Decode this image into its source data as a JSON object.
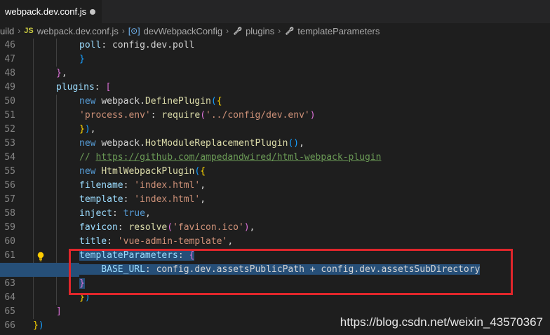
{
  "tab": {
    "title": "webpack.dev.conf.js"
  },
  "breadcrumb": {
    "items": [
      {
        "label": "uild"
      },
      {
        "label": "webpack.dev.conf.js",
        "icon": "js-file-icon"
      },
      {
        "label": "devWebpackConfig",
        "icon": "object-icon"
      },
      {
        "label": "plugins",
        "icon": "wrench-icon"
      },
      {
        "label": "templateParameters",
        "icon": "wrench-icon"
      }
    ]
  },
  "editor": {
    "line_numbers": [
      "46",
      "47",
      "48",
      "49",
      "50",
      "51",
      "52",
      "53",
      "54",
      "55",
      "56",
      "57",
      "58",
      "59",
      "60",
      "61",
      "62",
      "63",
      "64",
      "65",
      "66"
    ],
    "lines": [
      [
        {
          "t": "poll",
          "c": "p"
        },
        {
          "t": ": config.dev.poll",
          "c": "w"
        }
      ],
      [
        {
          "t": "}",
          "c": "b3"
        }
      ],
      [
        {
          "t": "}",
          "c": "b2"
        },
        {
          "t": ",",
          "c": "w"
        }
      ],
      [
        {
          "t": "plugins",
          "c": "p"
        },
        {
          "t": ": ",
          "c": "w"
        },
        {
          "t": "[",
          "c": "b2"
        }
      ],
      [
        {
          "t": "new ",
          "c": "k"
        },
        {
          "t": "webpack.",
          "c": "w"
        },
        {
          "t": "DefinePlugin",
          "c": "f"
        },
        {
          "t": "(",
          "c": "b3"
        },
        {
          "t": "{",
          "c": "b1"
        }
      ],
      [
        {
          "t": "'process.env'",
          "c": "s"
        },
        {
          "t": ": ",
          "c": "w"
        },
        {
          "t": "require",
          "c": "f"
        },
        {
          "t": "(",
          "c": "b2"
        },
        {
          "t": "'../config/dev.env'",
          "c": "s"
        },
        {
          "t": ")",
          "c": "b2"
        }
      ],
      [
        {
          "t": "}",
          "c": "b1"
        },
        {
          "t": ")",
          "c": "b3"
        },
        {
          "t": ",",
          "c": "w"
        }
      ],
      [
        {
          "t": "new ",
          "c": "k"
        },
        {
          "t": "webpack.",
          "c": "w"
        },
        {
          "t": "HotModuleReplacementPlugin",
          "c": "f"
        },
        {
          "t": "(",
          "c": "b3"
        },
        {
          "t": ")",
          "c": "b3"
        },
        {
          "t": ",",
          "c": "w"
        }
      ],
      [
        {
          "t": "// ",
          "c": "c"
        },
        {
          "t": "https://github.com/ampedandwired/html-webpack-plugin",
          "c": "cu"
        }
      ],
      [
        {
          "t": "new ",
          "c": "k"
        },
        {
          "t": "HtmlWebpackPlugin",
          "c": "f"
        },
        {
          "t": "(",
          "c": "b3"
        },
        {
          "t": "{",
          "c": "b1"
        }
      ],
      [
        {
          "t": "filename",
          "c": "p"
        },
        {
          "t": ": ",
          "c": "w"
        },
        {
          "t": "'index.html'",
          "c": "s"
        },
        {
          "t": ",",
          "c": "w"
        }
      ],
      [
        {
          "t": "template",
          "c": "p"
        },
        {
          "t": ": ",
          "c": "w"
        },
        {
          "t": "'index.html'",
          "c": "s"
        },
        {
          "t": ",",
          "c": "w"
        }
      ],
      [
        {
          "t": "inject",
          "c": "p"
        },
        {
          "t": ": ",
          "c": "w"
        },
        {
          "t": "true",
          "c": "k"
        },
        {
          "t": ",",
          "c": "w"
        }
      ],
      [
        {
          "t": "favicon",
          "c": "p"
        },
        {
          "t": ": ",
          "c": "w"
        },
        {
          "t": "resolve",
          "c": "f"
        },
        {
          "t": "(",
          "c": "b2"
        },
        {
          "t": "'favicon.ico'",
          "c": "s"
        },
        {
          "t": ")",
          "c": "b2"
        },
        {
          "t": ",",
          "c": "w"
        }
      ],
      [
        {
          "t": "title",
          "c": "p"
        },
        {
          "t": ": ",
          "c": "w"
        },
        {
          "t": "'vue-admin-template'",
          "c": "s"
        },
        {
          "t": ",",
          "c": "w"
        }
      ],
      [
        {
          "t": "templateParameters",
          "c": "p"
        },
        {
          "t": ": ",
          "c": "w"
        },
        {
          "t": "{",
          "c": "b2"
        }
      ],
      [
        {
          "t": "    BASE_URL",
          "c": "p"
        },
        {
          "t": ": config.dev.assetsPublicPath + config.dev.assetsSubDirectory",
          "c": "w"
        }
      ],
      [
        {
          "t": "}",
          "c": "b2"
        }
      ],
      [
        {
          "t": "}",
          "c": "b1"
        },
        {
          "t": ")",
          "c": "b3"
        }
      ],
      [
        {
          "t": "]",
          "c": "b2"
        }
      ],
      [
        {
          "t": "}",
          "c": "b1"
        },
        {
          "t": ")",
          "c": "b3"
        }
      ]
    ],
    "indents": [
      2,
      2,
      1,
      1,
      2,
      2,
      2,
      2,
      2,
      2,
      2,
      2,
      2,
      2,
      2,
      2,
      2,
      2,
      2,
      1,
      0
    ],
    "selected_lines": [
      "61",
      "62",
      "63"
    ]
  },
  "watermark": "https://blog.csdn.net/weixin_43570367",
  "colors": {
    "keyword": "#569cd6",
    "function": "#dcdcaa",
    "property": "#9cdcfe",
    "string": "#ce9178",
    "comment": "#6a9955",
    "selection": "#264f78",
    "highlight_box": "#e0262b"
  }
}
